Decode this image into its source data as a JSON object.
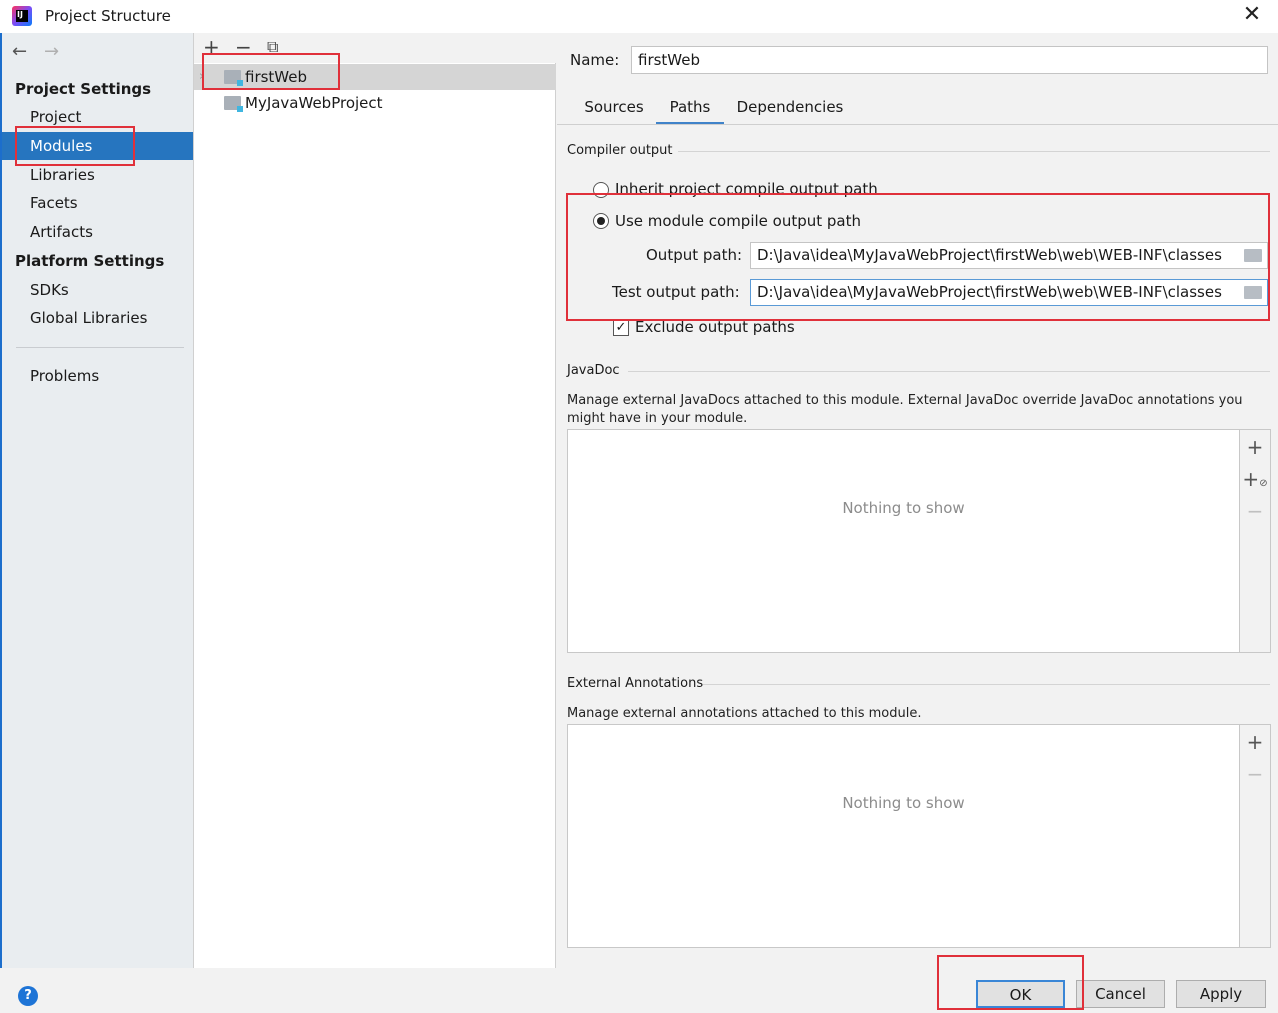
{
  "window": {
    "title": "Project Structure",
    "icon": "intellij-idea-icon",
    "close_icon": "close-icon"
  },
  "sidebar": {
    "back_icon": "arrow-left-icon",
    "forward_icon": "arrow-right-icon",
    "project_settings_heading": "Project Settings",
    "platform_settings_heading": "Platform Settings",
    "items": [
      "Project",
      "Modules",
      "Libraries",
      "Facets",
      "Artifacts",
      "SDKs",
      "Global Libraries",
      "Problems"
    ],
    "selected": "Modules"
  },
  "tree": {
    "toolbar": {
      "add_icon": "plus-icon",
      "remove_icon": "minus-icon",
      "copy_icon": "copy-icon"
    },
    "modules": [
      "firstWeb",
      "MyJavaWebProject"
    ],
    "selected": "firstWeb"
  },
  "module": {
    "name_label": "Name:",
    "name_value": "firstWeb",
    "tabs": [
      "Sources",
      "Paths",
      "Dependencies"
    ],
    "active_tab": "Paths"
  },
  "compiler_output": {
    "group_title": "Compiler output",
    "inherit_label": "Inherit project compile output path",
    "use_module_label": "Use module compile output path",
    "selected_option": "Use module compile output path",
    "output_path_label": "Output path:",
    "output_path_value": "D:\\Java\\idea\\MyJavaWebProject\\firstWeb\\web\\WEB-INF\\classes",
    "test_output_path_label": "Test output path:",
    "test_output_path_value": "D:\\Java\\idea\\MyJavaWebProject\\firstWeb\\web\\WEB-INF\\classes",
    "exclude_label": "Exclude output paths",
    "exclude_checked": true
  },
  "javadoc": {
    "group_title": "JavaDoc",
    "description": "Manage external JavaDocs attached to this module. External JavaDoc override JavaDoc annotations you might have in your module.",
    "empty_text": "Nothing to show"
  },
  "external_annotations": {
    "group_title": "External Annotations",
    "description": "Manage external annotations attached to this module.",
    "empty_text": "Nothing to show"
  },
  "buttons": {
    "ok": "OK",
    "cancel": "Cancel",
    "apply": "Apply",
    "help": "?"
  },
  "colors": {
    "selection": "#2675bf",
    "annotation": "#e0303a",
    "accent": "#4083c9"
  }
}
